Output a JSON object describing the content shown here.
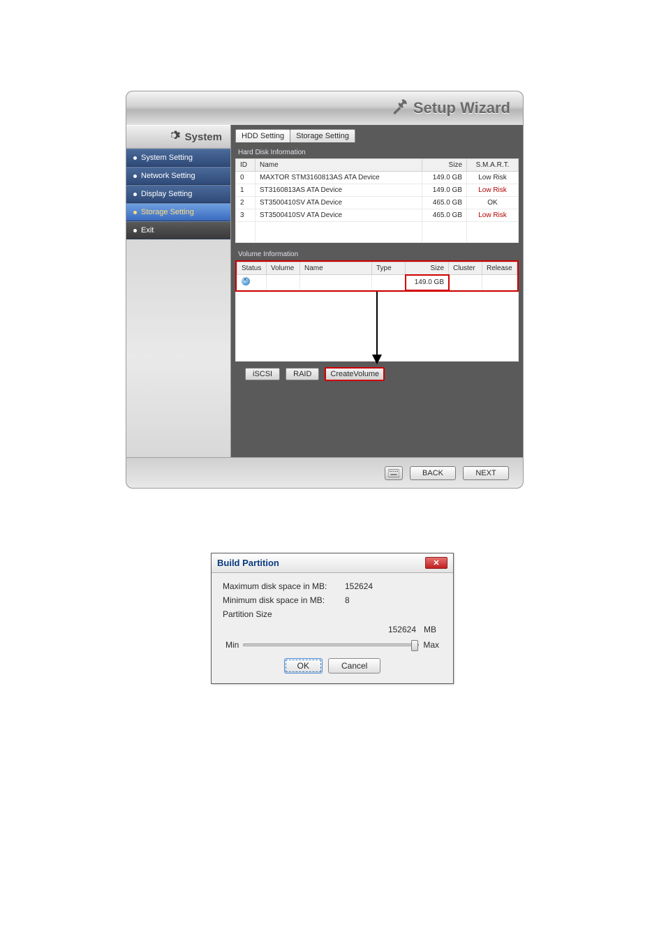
{
  "wizard": {
    "title": "Setup Wizard",
    "sidebar": {
      "group": "System",
      "items": [
        {
          "label": "System Setting"
        },
        {
          "label": "Network Setting"
        },
        {
          "label": "Display Setting"
        },
        {
          "label": "Storage Setting"
        },
        {
          "label": "Exit"
        }
      ]
    },
    "tabs": [
      {
        "label": "HDD Setting",
        "active": true
      },
      {
        "label": "Storage Setting",
        "active": false
      }
    ],
    "hdd": {
      "section_title": "Hard Disk Information",
      "headers": {
        "id": "ID",
        "name": "Name",
        "size": "Size",
        "smart": "S.M.A.R.T."
      },
      "rows": [
        {
          "id": "0",
          "name": "MAXTOR STM3160813AS ATA Device",
          "size": "149.0 GB",
          "smart": "Low Risk",
          "smart_red": false
        },
        {
          "id": "1",
          "name": "ST3160813AS ATA Device",
          "size": "149.0 GB",
          "smart": "Low Risk",
          "smart_red": true
        },
        {
          "id": "2",
          "name": "ST3500410SV ATA Device",
          "size": "465.0 GB",
          "smart": "OK",
          "smart_red": false
        },
        {
          "id": "3",
          "name": "ST3500410SV ATA Device",
          "size": "465.0 GB",
          "smart": "Low Risk",
          "smart_red": true
        }
      ]
    },
    "vol": {
      "section_title": "Volume Information",
      "headers": {
        "status": "Status",
        "volume": "Volume",
        "name": "Name",
        "type": "Type",
        "size": "Size",
        "cluster": "Cluster",
        "release": "Release"
      },
      "row": {
        "status": "error",
        "volume": "",
        "name": "",
        "type": "",
        "size": "149.0 GB",
        "cluster": "",
        "release": ""
      }
    },
    "actions": {
      "iscsi": "iSCSI",
      "raid": "RAID",
      "create": "CreateVolume"
    },
    "footer": {
      "back": "BACK",
      "next": "NEXT"
    }
  },
  "dialog": {
    "title": "Build Partition",
    "max_label": "Maximum disk space in MB:",
    "max_value": "152624",
    "min_label": "Minimum disk space in MB:",
    "min_value": "8",
    "partition_group": "Partition Size",
    "size_value": "152624",
    "size_unit": "MB",
    "slider_min": "Min",
    "slider_max": "Max",
    "ok": "OK",
    "cancel": "Cancel"
  }
}
